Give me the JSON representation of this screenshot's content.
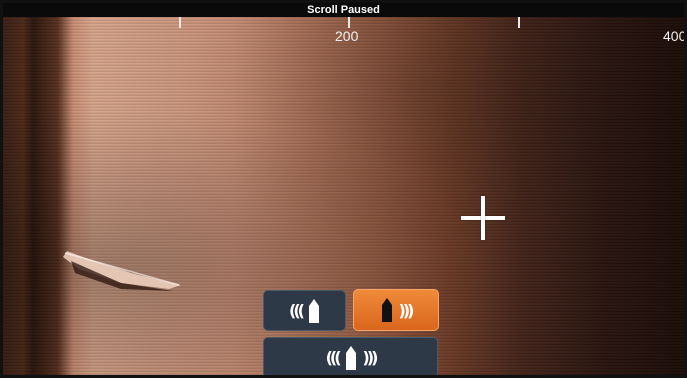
{
  "header": {
    "status": "Scroll Paused"
  },
  "ruler": {
    "labels": [
      "200",
      "400"
    ]
  },
  "view_mode_buttons": {
    "left_side": {
      "icon": "left-sidescan-icon",
      "active": false
    },
    "right_side": {
      "icon": "right-sidescan-icon",
      "active": true
    },
    "both_sides": {
      "icon": "both-sidescan-icon",
      "active": false
    }
  },
  "colors": {
    "active_button": "#e8772a",
    "inactive_button": "#2d3946",
    "sonar_bright": "#d8a58b",
    "sonar_dark": "#1a0c08"
  }
}
